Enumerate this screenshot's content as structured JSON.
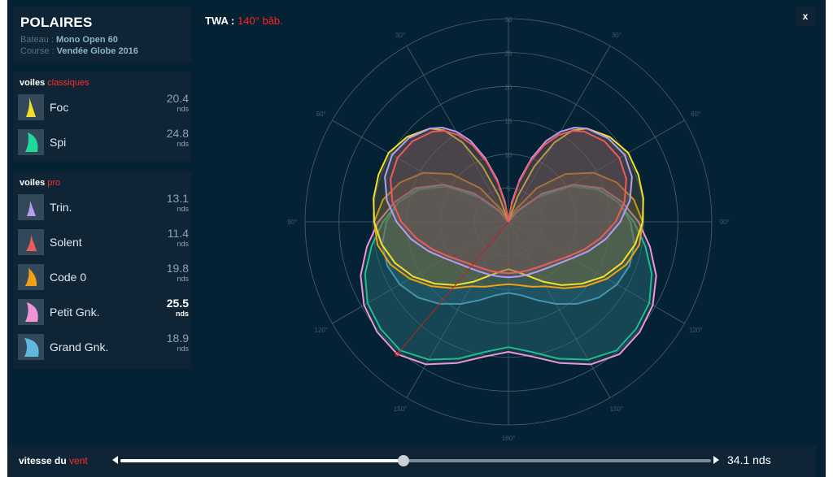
{
  "header": {
    "title": "POLAIRES",
    "boat_label": "Bateau :",
    "boat": "Mono Open 60",
    "race_label": "Course :",
    "race": "Vendée Globe 2016"
  },
  "twa": {
    "label": "TWA :",
    "value": "140° bâb."
  },
  "close_label": "x",
  "groups": [
    {
      "title": "voiles",
      "accent": "classiques",
      "sails": [
        {
          "name": "Foc",
          "speed": "20.4",
          "unit": "nds",
          "color": "#f2e02a",
          "icon": "jib-sail-icon"
        },
        {
          "name": "Spi",
          "speed": "24.8",
          "unit": "nds",
          "color": "#1fd99a",
          "icon": "spinnaker-sail-icon"
        }
      ]
    },
    {
      "title": "voiles",
      "accent": "pro",
      "sails": [
        {
          "name": "Trin.",
          "speed": "13.1",
          "unit": "nds",
          "color": "#b79cf0",
          "icon": "staysail-icon"
        },
        {
          "name": "Solent",
          "speed": "11.4",
          "unit": "nds",
          "color": "#ef5a5a",
          "icon": "solent-sail-icon"
        },
        {
          "name": "Code 0",
          "speed": "19.8",
          "unit": "nds",
          "color": "#f0a010",
          "icon": "code-zero-sail-icon"
        },
        {
          "name": "Petit Gnk.",
          "speed": "25.5",
          "unit": "nds",
          "color": "#f094d8",
          "icon": "small-gennaker-icon",
          "best": true
        },
        {
          "name": "Grand Gnk.",
          "speed": "18.9",
          "unit": "nds",
          "color": "#5fb8e0",
          "icon": "large-gennaker-icon"
        }
      ]
    }
  ],
  "wind": {
    "label": "vitesse du",
    "accent": "vent",
    "value": "34.1 nds",
    "position": 0.48
  },
  "chart_data": {
    "type": "polar",
    "angle_unit": "degrees",
    "radius_ticks": [
      "5",
      "10",
      "15",
      "20",
      "25",
      "30"
    ],
    "rmax": 30,
    "angle_labels": [
      {
        "angle": 30,
        "label": "30°"
      },
      {
        "angle": -30,
        "label": "30°"
      },
      {
        "angle": 60,
        "label": "60°"
      },
      {
        "angle": -60,
        "label": "60°"
      },
      {
        "angle": 90,
        "label": "90°"
      },
      {
        "angle": -90,
        "label": "90°"
      },
      {
        "angle": 120,
        "label": "120°"
      },
      {
        "angle": -120,
        "label": "120°"
      },
      {
        "angle": 150,
        "label": "150°"
      },
      {
        "angle": -150,
        "label": "150°"
      },
      {
        "angle": 180,
        "label": "180°"
      }
    ],
    "twa_angle": -140,
    "twa_speed": 25.5,
    "series": [
      {
        "sail": "Grand Gnk.",
        "color": "#5fb8e0",
        "fill": "#3a7fa6",
        "angles": [
          40,
          50,
          60,
          70,
          80,
          90,
          100,
          110,
          120,
          130,
          140,
          150,
          160,
          170,
          180
        ],
        "speeds": [
          2.0,
          5.5,
          10.5,
          14.2,
          16.5,
          18.0,
          18.9,
          19.0,
          18.5,
          17.4,
          15.8,
          14.0,
          12.3,
          11.0,
          10.5
        ]
      },
      {
        "sail": "Spi",
        "color": "#1fd99a",
        "fill": "#2a6e78",
        "angles": [
          40,
          50,
          60,
          70,
          80,
          90,
          100,
          110,
          120,
          130,
          140,
          150,
          160,
          170,
          180
        ],
        "speeds": [
          2.0,
          6.0,
          10.5,
          14.0,
          16.5,
          18.5,
          20.5,
          22.5,
          24.0,
          24.6,
          24.8,
          23.5,
          21.5,
          19.5,
          18.5
        ]
      },
      {
        "sail": "Petit Gnk.",
        "color": "#f094d8",
        "fill": "#2a6e78",
        "angles": [
          40,
          50,
          60,
          70,
          80,
          90,
          100,
          110,
          120,
          130,
          140,
          150,
          160,
          170,
          180
        ],
        "speeds": [
          2.2,
          6.5,
          11.0,
          14.6,
          17.0,
          19.2,
          21.2,
          23.2,
          24.6,
          25.3,
          25.5,
          24.3,
          22.2,
          20.2,
          19.2
        ]
      },
      {
        "sail": "Code 0",
        "color": "#f0a010",
        "fill": "#8a6a2a",
        "angles": [
          30,
          40,
          50,
          60,
          70,
          80,
          90,
          100,
          110,
          120,
          130,
          140,
          150,
          160,
          170,
          180
        ],
        "speeds": [
          2.0,
          6.5,
          11.0,
          14.5,
          17.0,
          18.8,
          19.8,
          19.6,
          18.5,
          16.8,
          14.8,
          12.8,
          11.0,
          10.2,
          9.5,
          9.2
        ]
      },
      {
        "sail": "Foc",
        "color": "#f2e02a",
        "fill": "#7a7440",
        "angles": [
          20,
          25,
          30,
          35,
          40,
          50,
          60,
          70,
          80,
          90,
          100,
          110,
          120,
          130,
          140,
          150,
          160,
          170,
          180
        ],
        "speeds": [
          4.0,
          9.0,
          13.5,
          16.5,
          18.0,
          19.5,
          20.4,
          20.4,
          20.2,
          19.8,
          19.0,
          17.8,
          16.2,
          14.2,
          12.2,
          10.2,
          8.5,
          7.5,
          7.0
        ]
      },
      {
        "sail": "Trin.",
        "color": "#b79cf0",
        "fill": "#6a5a78",
        "angles": [
          10,
          15,
          20,
          25,
          30,
          35,
          40,
          50,
          60,
          70,
          80,
          90,
          100,
          110,
          120,
          130,
          140,
          150,
          160,
          170,
          180
        ],
        "speeds": [
          3.0,
          6.5,
          10.0,
          13.2,
          15.4,
          17.0,
          18.0,
          19.2,
          19.8,
          19.4,
          18.2,
          16.5,
          14.6,
          12.6,
          10.8,
          9.6,
          8.9,
          8.5,
          8.3,
          8.2,
          8.2
        ]
      },
      {
        "sail": "Solent",
        "color": "#ef5a5a",
        "fill": "#7a4a4a",
        "angles": [
          10,
          15,
          20,
          25,
          30,
          35,
          40,
          50,
          60,
          70,
          80,
          90,
          100,
          110,
          120,
          130,
          140,
          150,
          160,
          170,
          180
        ],
        "speeds": [
          2.5,
          6.0,
          9.5,
          12.5,
          14.8,
          16.4,
          17.4,
          18.5,
          18.9,
          18.5,
          17.4,
          15.8,
          13.8,
          11.9,
          10.2,
          9.0,
          8.3,
          7.9,
          7.7,
          7.6,
          7.6
        ]
      }
    ]
  }
}
